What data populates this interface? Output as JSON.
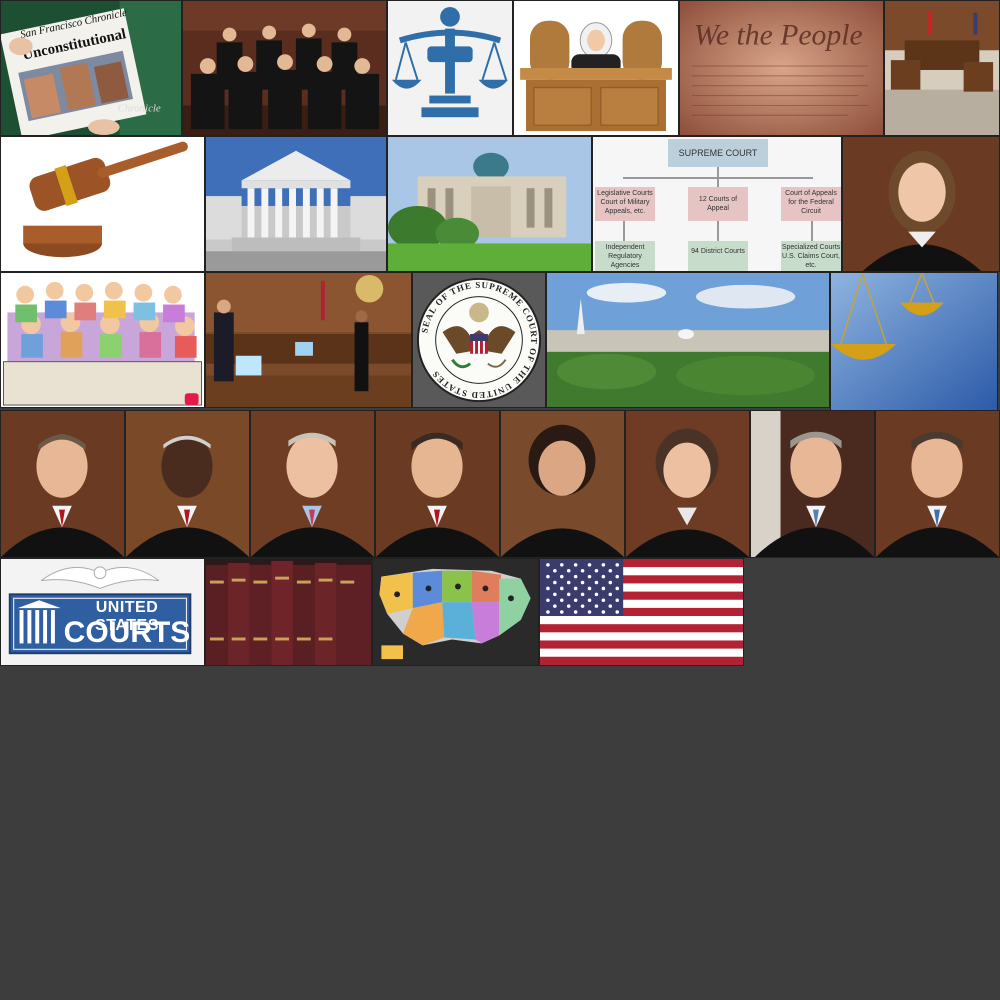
{
  "collage": {
    "newspaper": {
      "masthead": "San Francisco Chronicle",
      "headline": "Unconstitutional",
      "rack_label": "Chronicle"
    },
    "constitution": {
      "script": "We the People"
    },
    "org_chart": {
      "top": "SUPREME COURT",
      "row1": [
        "Legislative Courts Court of Military Appeals, etc.",
        "12 Courts of Appeal",
        "Court of Appeals for the Federal Circuit"
      ],
      "row2": [
        "Independent Regulatory Agencies",
        "94 District Courts",
        "Specialized Courts U.S. Claims Court, etc."
      ]
    },
    "seal": {
      "text": "SEAL OF THE SUPREME COURT OF THE UNITED STATES"
    },
    "us_courts": {
      "line1": "UNITED STATES",
      "line2": "COURTS"
    },
    "colors": {
      "background": "#3d3d3d",
      "icon_blue": "#2f6ea8",
      "robe": "#151515",
      "wood": "#6b3e1f",
      "flag_red": "#b22234",
      "flag_blue": "#3c3b6e"
    }
  }
}
